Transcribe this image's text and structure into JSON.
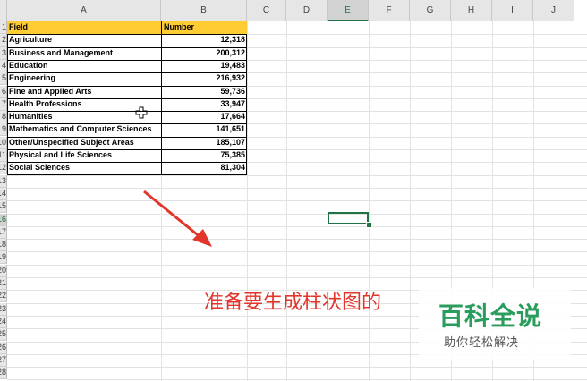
{
  "columns": [
    "A",
    "B",
    "C",
    "D",
    "E",
    "F",
    "G",
    "H",
    "I",
    "J"
  ],
  "active_column": "E",
  "row_numbers": [
    "1",
    "2",
    "3",
    "4",
    "5",
    "6",
    "7",
    "8",
    "9",
    "10",
    "11",
    "12",
    "13",
    "14",
    "15",
    "16",
    "17",
    "18",
    "19",
    "20",
    "21",
    "22",
    "23",
    "24",
    "25",
    "26",
    "27",
    "28"
  ],
  "active_row": "16",
  "table": {
    "headers": {
      "field": "Field",
      "number": "Number"
    },
    "rows": [
      {
        "field": "Agriculture",
        "number": "12,318"
      },
      {
        "field": "Business and Management",
        "number": "200,312"
      },
      {
        "field": "Education",
        "number": "19,483"
      },
      {
        "field": "Engineering",
        "number": "216,932"
      },
      {
        "field": "Fine and Applied Arts",
        "number": "59,736"
      },
      {
        "field": "Health Professions",
        "number": "33,947"
      },
      {
        "field": "Humanities",
        "number": "17,664"
      },
      {
        "field": "Mathematics and Computer Sciences",
        "number": "141,651"
      },
      {
        "field": "Other/Unspecified Subject Areas",
        "number": "185,107"
      },
      {
        "field": "Physical and Life Sciences",
        "number": "75,385"
      },
      {
        "field": "Social Sciences",
        "number": "81,304"
      }
    ]
  },
  "overlay": {
    "caption": "准备要生成柱状图的",
    "watermark_title": "百科全说",
    "watermark_subtitle": "助你轻松解决"
  },
  "colors": {
    "header_fill": "#ffcc33",
    "selection": "#217346",
    "caption": "#e0362c",
    "watermark": "#2a9d5c"
  }
}
